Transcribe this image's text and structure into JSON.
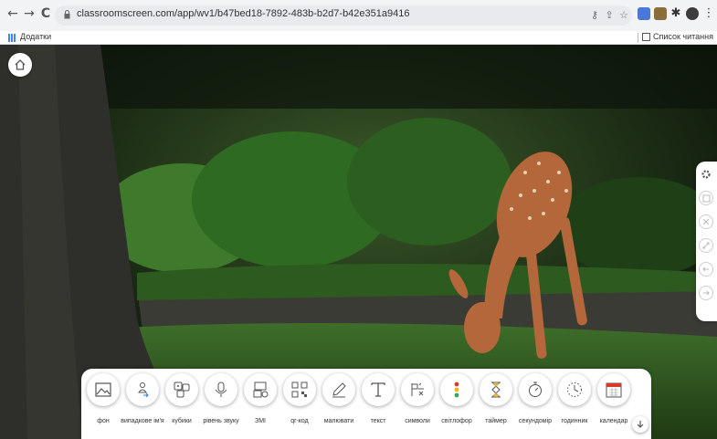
{
  "browser": {
    "url": "classroomscreen.com/app/wv1/b47bed18-7892-483b-b2d7-b42e351a9416",
    "back_icon": "←",
    "forward_icon": "→",
    "reload_icon": "C",
    "bookmarks_label": "Додатки",
    "reading_list_label": "Список читання"
  },
  "toolbar": {
    "tools": [
      {
        "label": "фон",
        "icon": "background-image-icon"
      },
      {
        "label": "випадкове ім'я",
        "icon": "random-name-icon"
      },
      {
        "label": "кубики",
        "icon": "dice-icon"
      },
      {
        "label": "рівень звуку",
        "icon": "microphone-icon"
      },
      {
        "label": "ЗМІ",
        "icon": "media-icon"
      },
      {
        "label": "qr-код",
        "icon": "qr-code-icon"
      },
      {
        "label": "малювати",
        "icon": "pencil-icon"
      },
      {
        "label": "текст",
        "icon": "text-icon"
      },
      {
        "label": "символи",
        "icon": "symbols-icon"
      },
      {
        "label": "світлофор",
        "icon": "traffic-light-icon"
      },
      {
        "label": "таймер",
        "icon": "hourglass-icon"
      },
      {
        "label": "секундомір",
        "icon": "stopwatch-icon"
      },
      {
        "label": "годинник",
        "icon": "clock-icon"
      },
      {
        "label": "календар",
        "icon": "calendar-icon"
      }
    ]
  },
  "side_panel": [
    "settings-icon",
    "save-icon",
    "shuffle-icon",
    "fullscreen-icon",
    "undo-icon",
    "redo-icon"
  ]
}
